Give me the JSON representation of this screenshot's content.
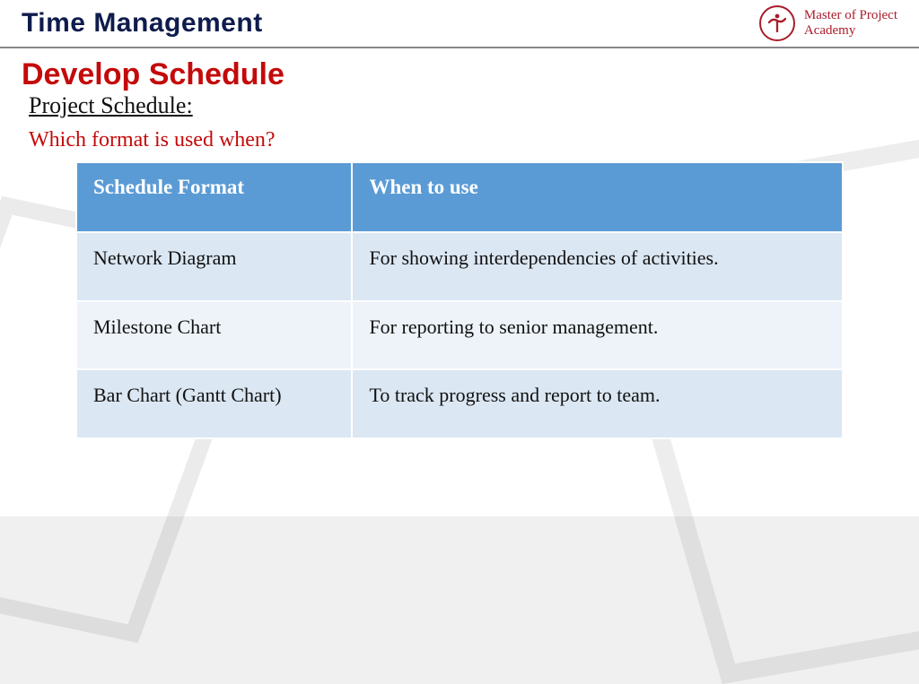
{
  "header": {
    "title": "Time Management",
    "brand_line1": "Master of Project",
    "brand_line2": "Academy"
  },
  "main": {
    "heading": "Develop Schedule",
    "subheading": "Project Schedule:",
    "question": "Which format is used when?"
  },
  "table": {
    "headers": [
      "Schedule Format",
      "When to use"
    ],
    "rows": [
      {
        "format": "Network Diagram",
        "when": "For showing interdependencies of activities."
      },
      {
        "format": "Milestone Chart",
        "when": "For reporting to senior management."
      },
      {
        "format": "Bar Chart (Gantt Chart)",
        "when": "To track progress and report to team."
      }
    ]
  }
}
